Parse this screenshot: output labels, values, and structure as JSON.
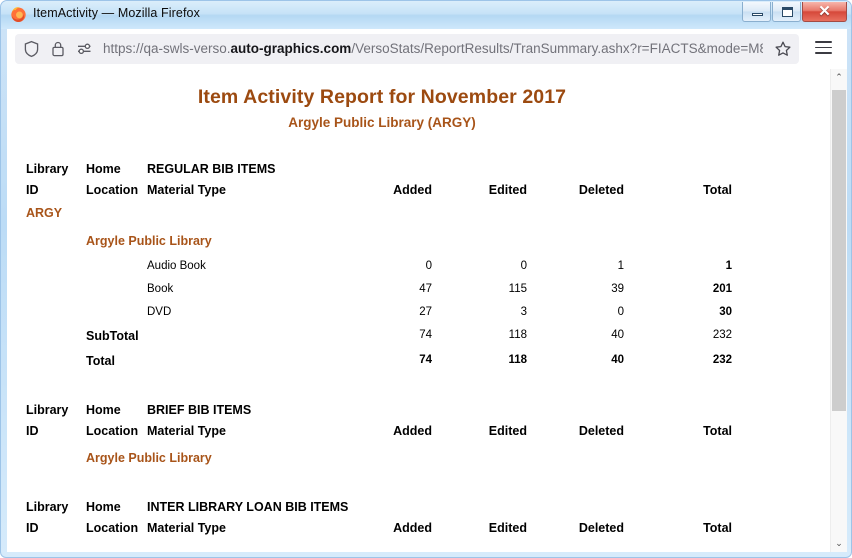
{
  "window": {
    "title": "ItemActivity — Mozilla Firefox",
    "minimize_label": "Minimize",
    "maximize_label": "Maximize",
    "close_label": "✕"
  },
  "browser": {
    "url_prefix": "https://qa-swls-verso.",
    "url_domain": "auto-graphics.com",
    "url_suffix": "/VersoStats/ReportResults/TranSummary.ashx?r=FIACTS&mode=M8",
    "url_full": "https://qa-swls-verso.auto-graphics.com/VersoStats/ReportResults/TranSummary.ashx?r=FIACTS&mode=M8",
    "icons": {
      "shield": "shield-icon",
      "lock": "lock-icon",
      "permissions": "permissions-icon",
      "bookmark": "star-icon",
      "menu": "hamburger-icon"
    }
  },
  "report": {
    "title": "Item Activity Report for November 2017",
    "subtitle": "Argyle Public Library (ARGY)",
    "accent_color": "#9C4A10",
    "columns": {
      "library_id_l1": "Library",
      "library_id_l2": "ID",
      "home_location_l1": "Home",
      "home_location_l2": "Location",
      "material_type": "Material Type",
      "added": "Added",
      "edited": "Edited",
      "deleted": "Deleted",
      "total": "Total"
    },
    "sections": [
      {
        "heading": "REGULAR BIB ITEMS",
        "library_id": "ARGY",
        "location": "Argyle Public Library",
        "rows": [
          {
            "material_type": "Audio Book",
            "added": "0",
            "edited": "0",
            "deleted": "1",
            "total": "1"
          },
          {
            "material_type": "Book",
            "added": "47",
            "edited": "115",
            "deleted": "39",
            "total": "201"
          },
          {
            "material_type": "DVD",
            "added": "27",
            "edited": "3",
            "deleted": "0",
            "total": "30"
          }
        ],
        "subtotal": {
          "label": "SubTotal",
          "added": "74",
          "edited": "118",
          "deleted": "40",
          "total": "232"
        },
        "total": {
          "label": "Total",
          "added": "74",
          "edited": "118",
          "deleted": "40",
          "total": "232"
        }
      },
      {
        "heading": "BRIEF BIB ITEMS",
        "library_id": "",
        "location": "Argyle Public Library",
        "rows": [],
        "subtotal": null,
        "total": null
      },
      {
        "heading": "INTER LIBRARY LOAN BIB ITEMS",
        "library_id": "",
        "location": "",
        "rows": [],
        "subtotal": null,
        "total": null
      }
    ]
  },
  "scrollbar": {
    "up_arrow": "⌃",
    "down_arrow": "⌄"
  }
}
